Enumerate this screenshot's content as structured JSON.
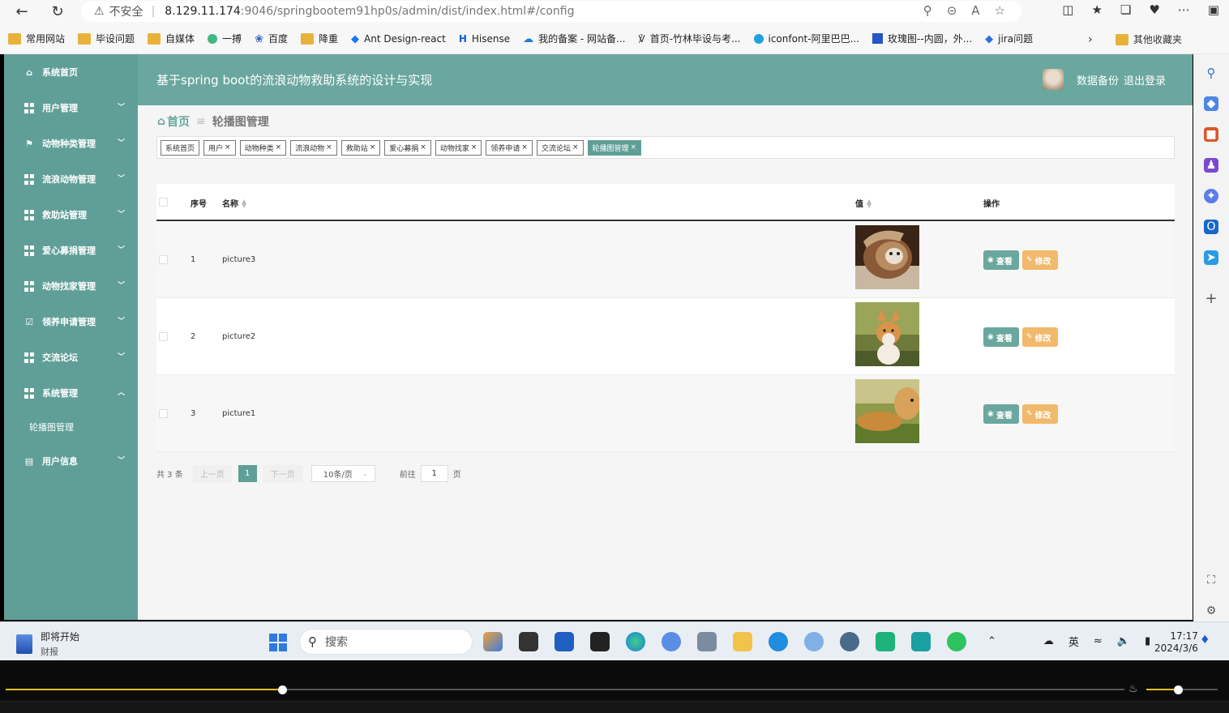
{
  "browser": {
    "security_label": "不安全",
    "url_host": "8.129.11.174",
    "url_rest": ":9046/springbootem91hp0s/admin/dist/index.html#/config",
    "bookmarks": [
      {
        "label": "常用网站",
        "icon": "folder-icon"
      },
      {
        "label": "毕设问题",
        "icon": "folder-icon"
      },
      {
        "label": "自媒体",
        "icon": "folder-icon"
      },
      {
        "label": "一搏",
        "icon": "vue-icon"
      },
      {
        "label": "百度",
        "icon": "baidu-icon"
      },
      {
        "label": "降重",
        "icon": "folder-icon"
      },
      {
        "label": "Ant Design-react",
        "icon": "antd-icon"
      },
      {
        "label": "Hisense",
        "icon": "hisense-icon"
      },
      {
        "label": "我的备案 - 网站备...",
        "icon": "cloud-icon"
      },
      {
        "label": "首页-竹林毕设与考...",
        "icon": "bamboo-icon"
      },
      {
        "label": "iconfont-阿里巴巴...",
        "icon": "iconfont-icon"
      },
      {
        "label": "玫瑰图--内圆，外...",
        "icon": "chart-icon"
      },
      {
        "label": "jira问题",
        "icon": "jira-icon"
      }
    ],
    "other_bookmarks": "其他收藏夹"
  },
  "app": {
    "title": "基于spring boot的流浪动物救助系统的设计与实现",
    "top_right": {
      "backup": "数据备份",
      "logout": "退出登录"
    },
    "sidebar": [
      {
        "label": "系统首页",
        "icon": "home-icon",
        "chevron": ""
      },
      {
        "label": "用户管理",
        "icon": "grid-icon",
        "chevron": "﹀"
      },
      {
        "label": "动物种类管理",
        "icon": "flag-icon",
        "chevron": "﹀"
      },
      {
        "label": "流浪动物管理",
        "icon": "grid-icon",
        "chevron": "﹀"
      },
      {
        "label": "救助站管理",
        "icon": "grid-icon",
        "chevron": "﹀"
      },
      {
        "label": "爱心募捐管理",
        "icon": "grid-icon",
        "chevron": "﹀"
      },
      {
        "label": "动物找家管理",
        "icon": "grid-icon",
        "chevron": "﹀"
      },
      {
        "label": "领养申请管理",
        "icon": "check-square-icon",
        "chevron": "﹀"
      },
      {
        "label": "交流论坛",
        "icon": "grid-icon",
        "chevron": "﹀"
      },
      {
        "label": "系统管理",
        "icon": "grid-icon",
        "chevron": "︿"
      }
    ],
    "sidebar_sub": "轮播图管理",
    "sidebar_last": {
      "label": "用户信息",
      "icon": "card-icon",
      "chevron": "﹀"
    },
    "breadcrumb": {
      "home": "首页",
      "sep": "≡",
      "current": "轮播图管理"
    },
    "tags": [
      {
        "label": "系统首页",
        "closable": false,
        "active": false
      },
      {
        "label": "用户",
        "closable": true,
        "active": false
      },
      {
        "label": "动物种类",
        "closable": true,
        "active": false
      },
      {
        "label": "流浪动物",
        "closable": true,
        "active": false
      },
      {
        "label": "救助站",
        "closable": true,
        "active": false
      },
      {
        "label": "爱心募捐",
        "closable": true,
        "active": false
      },
      {
        "label": "动物找家",
        "closable": true,
        "active": false
      },
      {
        "label": "领养申请",
        "closable": true,
        "active": false
      },
      {
        "label": "交流论坛",
        "closable": true,
        "active": false
      },
      {
        "label": "轮播图管理",
        "closable": true,
        "active": true
      }
    ],
    "table": {
      "headers": {
        "index": "序号",
        "name": "名称",
        "value": "值",
        "actions": "操作"
      },
      "rows": [
        {
          "index": "1",
          "name": "picture3",
          "image": "cat-photo"
        },
        {
          "index": "2",
          "name": "picture2",
          "image": "corgi-photo"
        },
        {
          "index": "3",
          "name": "picture1",
          "image": "golden-retriever-photo"
        }
      ],
      "view_label": "查看",
      "edit_label": "修改"
    },
    "pager": {
      "total": "共 3 条",
      "prev": "上一页",
      "current": "1",
      "next": "下一页",
      "size": "10条/页",
      "goto": "前往",
      "goto_value": "1",
      "page_unit": "页"
    }
  },
  "taskbar": {
    "weather_title": "即将开始",
    "weather_sub": "财报",
    "search_placeholder": "搜索",
    "ime": "英",
    "time": "17:17",
    "date": "2024/3/6"
  },
  "video": {
    "progress": 0.25,
    "volume": 0.45
  },
  "colors": {
    "accent": "#5f9f97",
    "topbar": "#6aa79e",
    "edit": "#f1b96b"
  }
}
